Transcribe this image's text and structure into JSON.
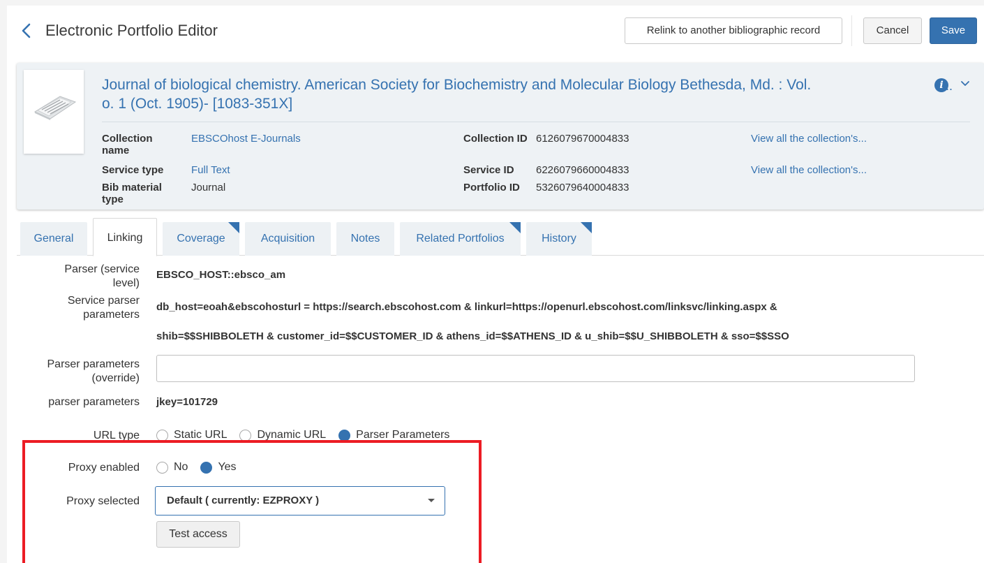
{
  "header": {
    "title": "Electronic Portfolio Editor",
    "relink_label": "Relink to another bibliographic record",
    "cancel_label": "Cancel",
    "save_label": "Save",
    "accent_color": "#3572b0"
  },
  "record": {
    "title_line1": "Journal of biological chemistry. American Society for Biochemistry and Molecular Biology Bethesda, Md. : Vol.",
    "title_line2": "o. 1 (Oct. 1905)- [1083-351X]",
    "ellipsis": "..",
    "info_icon": "i",
    "fields": {
      "collection_name_label": "Collection name",
      "collection_name_value": "EBSCOhost E-Journals",
      "service_type_label": "Service type",
      "service_type_value": "Full Text",
      "bib_material_type_label": "Bib material type",
      "bib_material_type_value": "Journal",
      "collection_id_label": "Collection ID",
      "collection_id_value": "6126079670004833",
      "service_id_label": "Service ID",
      "service_id_value": "6226079660004833",
      "portfolio_id_label": "Portfolio ID",
      "portfolio_id_value": "5326079640004833",
      "view_collection_link_1": "View all the collection's...",
      "view_collection_link_2": "View all the collection's..."
    }
  },
  "tabs": [
    {
      "label": "General",
      "active": false,
      "flag": false
    },
    {
      "label": "Linking",
      "active": true,
      "flag": false
    },
    {
      "label": "Coverage",
      "active": false,
      "flag": true
    },
    {
      "label": "Acquisition",
      "active": false,
      "flag": false
    },
    {
      "label": "Notes",
      "active": false,
      "flag": false
    },
    {
      "label": "Related Portfolios",
      "active": false,
      "flag": true
    },
    {
      "label": "History",
      "active": false,
      "flag": true
    }
  ],
  "linking": {
    "parser_service_label_1": "Parser (service",
    "parser_service_label_2": "level)",
    "parser_service_value": "EBSCO_HOST::ebsco_am",
    "service_params_label_1": "Service parser",
    "service_params_label_2": "parameters",
    "service_params_line1": "db_host=eoah&ebscohosturl = https://search.ebscohost.com & linkurl=https://openurl.ebscohost.com/linksvc/linking.aspx &",
    "service_params_line2": "shib=$$SHIBBOLETH & customer_id=$$CUSTOMER_ID & athens_id=$$ATHENS_ID & u_shib=$$U_SHIBBOLETH & sso=$$SSO",
    "override_label_1": "Parser parameters",
    "override_label_2": "(override)",
    "override_value": "",
    "parser_params_label": "parser parameters",
    "parser_params_value": "jkey=101729",
    "url_type_label": "URL type",
    "url_type_options": [
      "Static URL",
      "Dynamic URL",
      "Parser Parameters"
    ],
    "url_type_selected": "Parser Parameters",
    "proxy_enabled_label": "Proxy enabled",
    "proxy_enabled_options": [
      "No",
      "Yes"
    ],
    "proxy_enabled_selected": "Yes",
    "proxy_selected_label": "Proxy selected",
    "proxy_selected_value": "Default ( currently: EZPROXY )",
    "test_access_label": "Test access",
    "highlight_color": "#ec1c24"
  }
}
